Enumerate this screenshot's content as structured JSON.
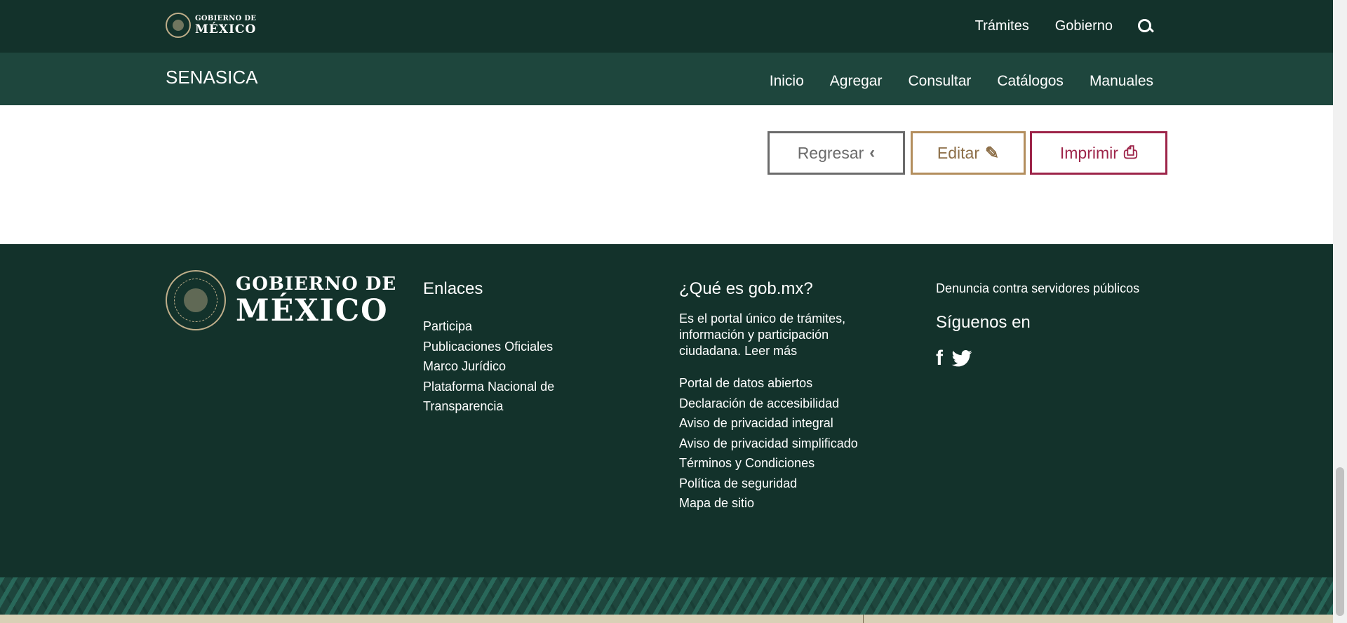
{
  "header": {
    "logo": {
      "line1": "GOBIERNO DE",
      "line2": "MÉXICO"
    },
    "nav": [
      "Trámites",
      "Gobierno"
    ],
    "search_icon": "search-icon"
  },
  "subheader": {
    "brand": "SENASICA",
    "nav": [
      "Inicio",
      "Agregar",
      "Consultar",
      "Catálogos",
      "Manuales"
    ]
  },
  "actions": {
    "back_label": "Regresar",
    "back_icon": "‹",
    "edit_label": "Editar",
    "edit_icon": "✎",
    "print_label": "Imprimir",
    "print_icon": "⎙"
  },
  "footer": {
    "logo": {
      "line1": "GOBIERNO DE",
      "line2": "MÉXICO"
    },
    "enlaces": {
      "title": "Enlaces",
      "links": [
        "Participa",
        "Publicaciones Oficiales",
        "Marco Jurídico",
        "Plataforma Nacional de Transparencia"
      ]
    },
    "gobmx": {
      "title": "¿Qué es gob.mx?",
      "description": "Es el portal único de trámites, información y participación ciudadana. Leer más",
      "links": [
        "Portal de datos abiertos",
        "Declaración de accesibilidad",
        "Aviso de privacidad integral",
        "Aviso de privacidad simplificado",
        "Términos y Condiciones",
        "Política de seguridad",
        "Mapa de sitio"
      ]
    },
    "right": {
      "denuncia": "Denuncia contra servidores públicos",
      "siguenos": "Síguenos en",
      "facebook_icon": "f"
    }
  },
  "colors": {
    "header_bg": "#13322b",
    "subheader_bg": "#1e463d",
    "back_border": "#6b6b6b",
    "edit_border": "#b38e5d",
    "print_border": "#9d2449"
  }
}
